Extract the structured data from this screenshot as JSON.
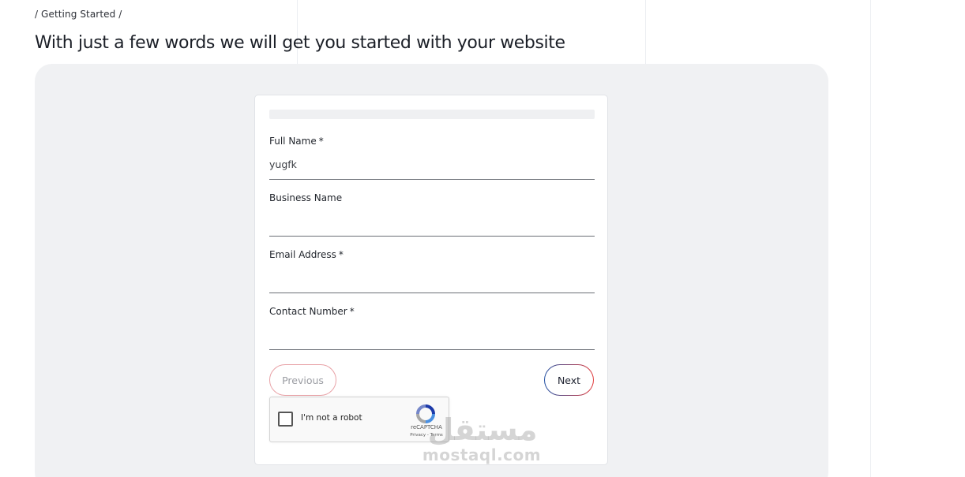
{
  "breadcrumb": {
    "text": "/ Getting Started /"
  },
  "page": {
    "title": "With just a few words we will get you started with your website"
  },
  "form": {
    "progress_percent": 0,
    "fields": [
      {
        "label": "Full Name",
        "required_mark": "*",
        "value": "yugfk"
      },
      {
        "label": "Business Name",
        "required_mark": "",
        "value": ""
      },
      {
        "label": "Email Address",
        "required_mark": "*",
        "value": ""
      },
      {
        "label": "Contact Number",
        "required_mark": "*",
        "value": ""
      }
    ],
    "previous_label": "Previous",
    "next_label": "Next"
  },
  "recaptcha": {
    "label": "I'm not a robot",
    "brand": "reCAPTCHA",
    "links": "Privacy - Terms",
    "icon": "recaptcha-logo-icon"
  },
  "watermark": {
    "arabic_text": "مستقل",
    "latin_text": "mostaql.com"
  },
  "colors": {
    "panel_bg": "#f0f1f3",
    "next_border_start": "#1f4fa3",
    "next_border_end": "#e33a3a",
    "previous_border": "#e8a1a6"
  }
}
